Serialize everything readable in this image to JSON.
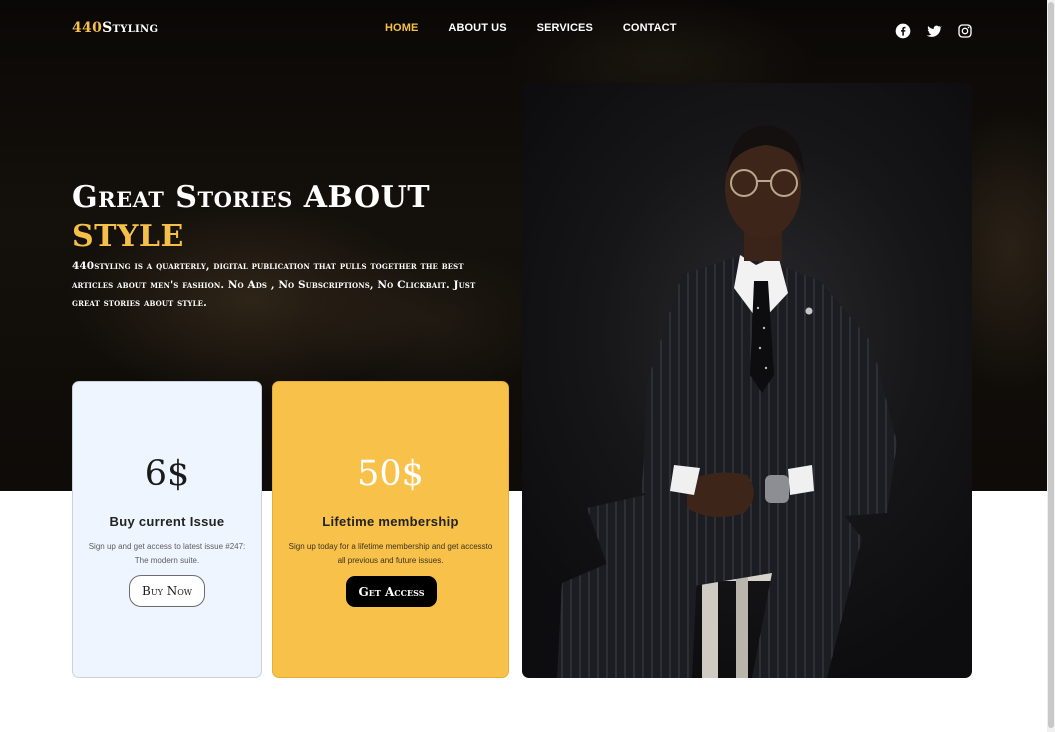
{
  "header": {
    "logo_number": "440",
    "logo_text": "Styling",
    "nav": [
      {
        "label": "HOME",
        "active": true
      },
      {
        "label": "ABOUT US",
        "active": false
      },
      {
        "label": "SERVICES",
        "active": false
      },
      {
        "label": "CONTACT",
        "active": false
      }
    ],
    "social_icons": [
      "facebook-icon",
      "twitter-icon",
      "instagram-icon"
    ]
  },
  "hero": {
    "title": "Great Stories ABOUT",
    "title_accent": "STYLE",
    "description": "440styling is a quarterly, digital publication that pulls together the best articles about men's fashion. No Ads , No Subscriptions, No Clickbait. Just great stories about style."
  },
  "cards": [
    {
      "price": "6$",
      "title": "Buy current Issue",
      "text": "Sign up and get access to latest issue #247: The modern suite.",
      "button": "Buy Now"
    },
    {
      "price": "50$",
      "title": "Lifetime membership",
      "text": "Sign up today for a lifetime membership and get accessto all previous and future issues.",
      "button": "Get Access"
    }
  ],
  "colors": {
    "accent": "#f5c049",
    "card_gold": "#f8c14a",
    "card_blue": "#eef5fe",
    "hero_dark": "#0e0b08"
  }
}
